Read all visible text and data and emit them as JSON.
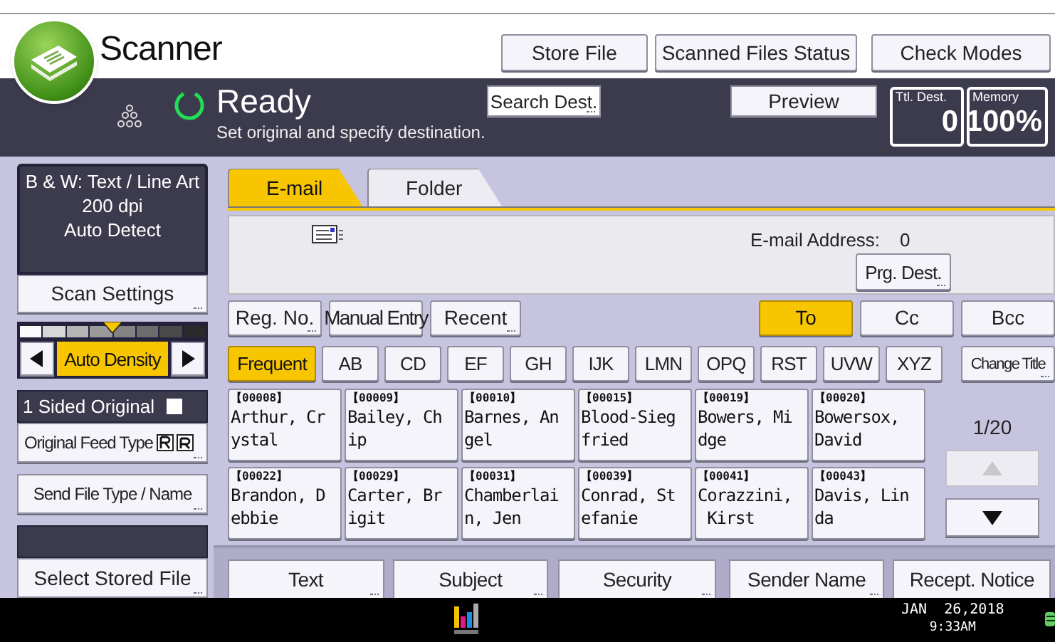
{
  "header": {
    "title": "Scanner",
    "buttons": [
      {
        "label": "Store File"
      },
      {
        "label": "Scanned Files Status"
      },
      {
        "label": "Check Modes"
      }
    ]
  },
  "status": {
    "title": "Ready",
    "message": "Set original and specify destination.",
    "search_button": {
      "label": "Search Dest.",
      "more": true
    },
    "preview_button": {
      "label": "Preview"
    },
    "counters": [
      {
        "label": "Ttl. Dest.",
        "value": "0"
      },
      {
        "label": "Memory",
        "value": "100%"
      }
    ]
  },
  "settings": {
    "summary": [
      "B & W: Text / Line Art",
      "200 dpi",
      "Auto Detect"
    ],
    "scan_button": {
      "label": "Scan Settings",
      "more": true
    },
    "density": {
      "level": 0.5,
      "label": "Auto Density",
      "selected": true
    },
    "original": {
      "label": "1 Sided Original"
    },
    "feed_button": {
      "label": "Original Feed Type",
      "more": true
    },
    "send_button": {
      "label": "Send File Type / Name",
      "more": true
    },
    "stored_button": {
      "label": "Select Stored File",
      "more": true
    }
  },
  "tabs": [
    {
      "label": "E-mail",
      "selected": true
    },
    {
      "label": "Folder",
      "selected": false
    }
  ],
  "destination": {
    "address_label": "E-mail Address:",
    "address_count": "0",
    "prg_button": {
      "label": "Prg. Dest.",
      "more": true
    }
  },
  "mode_buttons": [
    {
      "label": "Reg. No.",
      "more": true
    },
    {
      "label": "Manual Entry",
      "more": false
    },
    {
      "label": "Recent",
      "more": true
    }
  ],
  "recipient_types": [
    {
      "label": "To",
      "selected": true
    },
    {
      "label": "Cc",
      "selected": false
    },
    {
      "label": "Bcc",
      "selected": false
    }
  ],
  "index_tabs": [
    {
      "label": "Frequent",
      "selected": true
    },
    {
      "label": "AB",
      "selected": false
    },
    {
      "label": "CD",
      "selected": false
    },
    {
      "label": "EF",
      "selected": false
    },
    {
      "label": "GH",
      "selected": false
    },
    {
      "label": "IJK",
      "selected": false
    },
    {
      "label": "LMN",
      "selected": false
    },
    {
      "label": "OPQ",
      "selected": false
    },
    {
      "label": "RST",
      "selected": false
    },
    {
      "label": "UVW",
      "selected": false
    },
    {
      "label": "XYZ",
      "selected": false
    }
  ],
  "change_title": {
    "label": "Change Title",
    "more": true
  },
  "entries": [
    {
      "number": "【00008】",
      "lines": [
        "Arthur, Cr",
        "ystal"
      ]
    },
    {
      "number": "【00009】",
      "lines": [
        "Bailey, Ch",
        "ip"
      ]
    },
    {
      "number": "【00010】",
      "lines": [
        "Barnes, An",
        "gel"
      ]
    },
    {
      "number": "【00015】",
      "lines": [
        "Blood-Sieg",
        "fried"
      ]
    },
    {
      "number": "【00019】",
      "lines": [
        "Bowers, Mi",
        "dge"
      ]
    },
    {
      "number": "【00020】",
      "lines": [
        "Bowersox,",
        "David"
      ]
    },
    {
      "number": "【00022】",
      "lines": [
        "Brandon, D",
        "ebbie"
      ]
    },
    {
      "number": "【00029】",
      "lines": [
        "Carter, Br",
        "igit"
      ]
    },
    {
      "number": "【00031】",
      "lines": [
        "Chamberlai",
        "n, Jen"
      ]
    },
    {
      "number": "【00039】",
      "lines": [
        "Conrad, St",
        "efanie"
      ]
    },
    {
      "number": "【00041】",
      "lines": [
        "Corazzini,",
        " Kirst"
      ]
    },
    {
      "number": "【00043】",
      "lines": [
        "Davis, Lin",
        "da"
      ]
    }
  ],
  "pager": {
    "page": "1/20",
    "up_disabled": true,
    "down_disabled": false
  },
  "option_buttons": [
    {
      "label": "Text",
      "more": true
    },
    {
      "label": "Subject",
      "more": true
    },
    {
      "label": "Security",
      "more": true
    },
    {
      "label": "Sender Name",
      "more": true
    },
    {
      "label": "Recept. Notice",
      "more": false
    }
  ],
  "footer": {
    "date": "JAN  26,2018",
    "time": "9:33AM"
  }
}
